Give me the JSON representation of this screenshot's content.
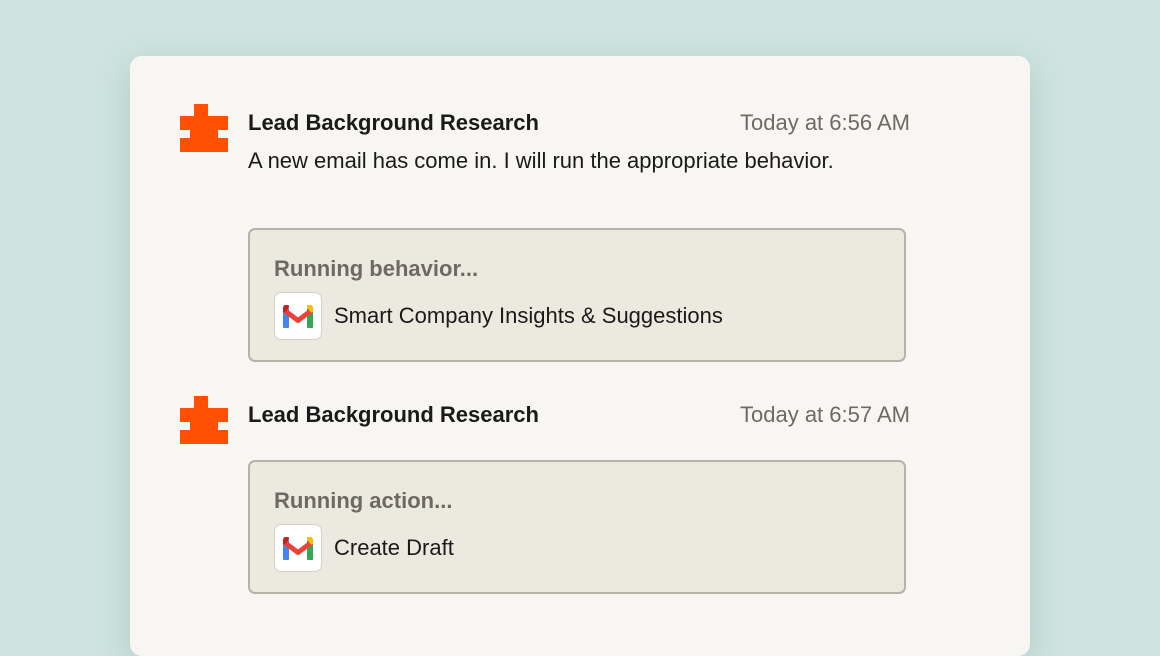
{
  "colors": {
    "background": "#cfe4e1",
    "panel": "#f8f6f3",
    "brand_orange": "#ff4f00",
    "card_bg": "#ece9de",
    "card_border": "#b5b2a9",
    "muted_text": "#6e6a63"
  },
  "messages": [
    {
      "avatar_icon": "agent-puzzle-icon",
      "agent_name": "Lead Background Research",
      "timestamp": "Today at 6:56 AM",
      "body": "A new email has come in. I will run the appropriate behavior.",
      "run": {
        "status": "Running behavior...",
        "app_icon": "gmail-icon",
        "label": "Smart Company Insights & Suggestions"
      }
    },
    {
      "avatar_icon": "agent-puzzle-icon",
      "agent_name": "Lead Background Research",
      "timestamp": "Today at 6:57 AM",
      "body": "",
      "run": {
        "status": "Running action...",
        "app_icon": "gmail-icon",
        "label": "Create Draft"
      }
    }
  ]
}
